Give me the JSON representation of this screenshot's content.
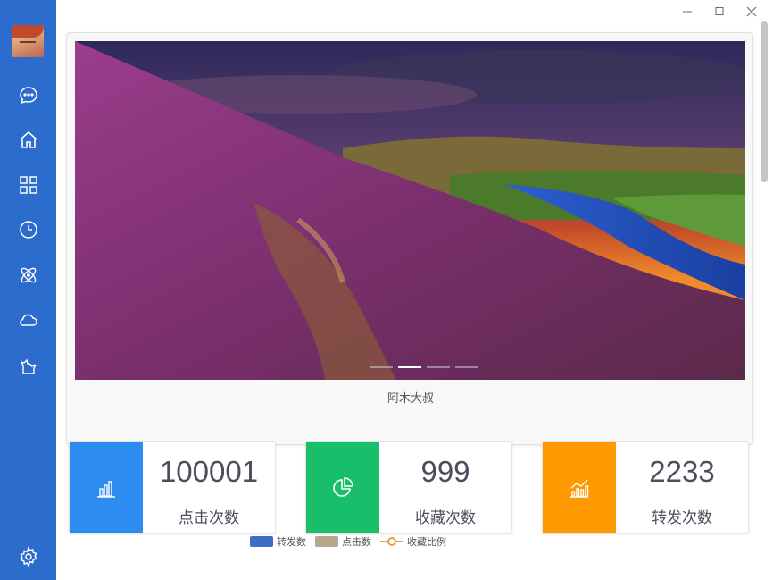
{
  "window": {
    "controls": [
      {
        "icon": "minimize-icon"
      },
      {
        "icon": "maximize-icon"
      },
      {
        "icon": "close-icon"
      }
    ]
  },
  "sidebar": {
    "accent": "#2b6ccc",
    "items": [
      {
        "icon": "chat-icon"
      },
      {
        "icon": "home-icon"
      },
      {
        "icon": "grid-icon"
      },
      {
        "icon": "clock-icon"
      },
      {
        "icon": "atom-icon"
      },
      {
        "icon": "cloud-icon"
      },
      {
        "icon": "cat-icon"
      }
    ],
    "settings_icon": "gear-icon"
  },
  "banner": {
    "caption": "阿木大叔"
  },
  "stats": [
    {
      "value": "100001",
      "label": "点击次数",
      "color": "#2d8cf0",
      "icon": "bar-chart-icon"
    },
    {
      "value": "999",
      "label": "收藏次数",
      "color": "#19be6b",
      "icon": "pie-chart-icon"
    },
    {
      "value": "2233",
      "label": "转发次数",
      "color": "#ff9900",
      "icon": "trend-chart-icon"
    }
  ],
  "legend": {
    "items": [
      {
        "label": "转发数",
        "color": "#3a6fc4"
      },
      {
        "label": "点击数",
        "color": "#b5a88f"
      },
      {
        "label": "收藏比例",
        "color": "#e8a23c"
      }
    ]
  }
}
